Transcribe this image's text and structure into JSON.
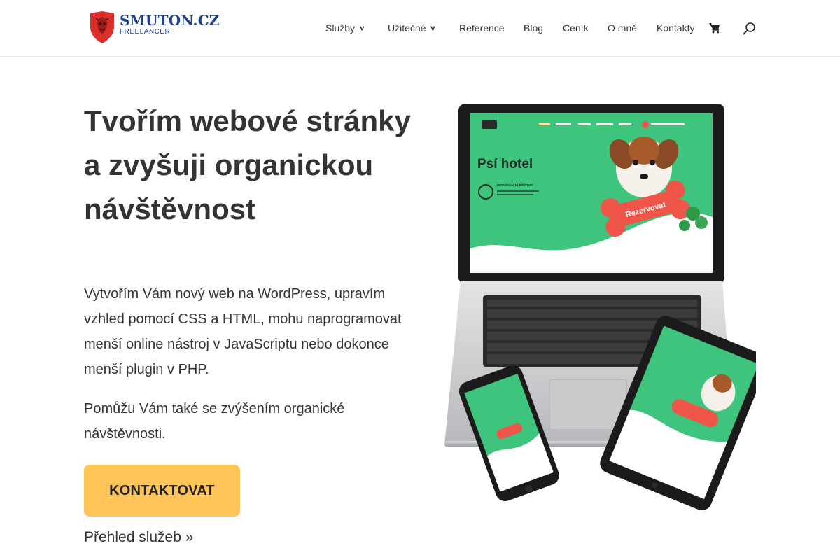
{
  "brand": {
    "name": "SMUTON.CZ",
    "tagline": "FREELANCER"
  },
  "nav": {
    "items": [
      {
        "label": "Služby",
        "has_dropdown": true
      },
      {
        "label": "Užitečné",
        "has_dropdown": true
      },
      {
        "label": "Reference",
        "has_dropdown": false
      },
      {
        "label": "Blog",
        "has_dropdown": false
      },
      {
        "label": "Ceník",
        "has_dropdown": false
      },
      {
        "label": "O mně",
        "has_dropdown": false
      },
      {
        "label": "Kontakty",
        "has_dropdown": false
      }
    ],
    "cart_icon": "shopping-cart-icon",
    "search_icon": "search-icon"
  },
  "hero": {
    "title": "Tvořím webové stránky a zvyšuji organickou návštěvnost",
    "paragraph1": "Vytvořím Vám nový web na WordPress, upravím vzhled pomocí CSS a HTML, mohu naprogramovat menší online nástroj v JavaScriptu nebo dokonce menší plugin v PHP.",
    "paragraph2": "Pomůžu Vám také se zvýšením organické návštěvnosti.",
    "cta_label": "KONTAKTOVAT",
    "services_link": "Přehled služeb »"
  },
  "mockup": {
    "site_title": "Psí hotel",
    "button_label": "Rezervovat",
    "feature_label": "INDIVIDUÁLNÍ PŘÍSTUP"
  },
  "colors": {
    "brand_blue": "#1d3f8f",
    "brand_red": "#d9302b",
    "cta_yellow": "#fec457",
    "mockup_green": "#3ec47c",
    "mockup_coral": "#f0554a"
  }
}
